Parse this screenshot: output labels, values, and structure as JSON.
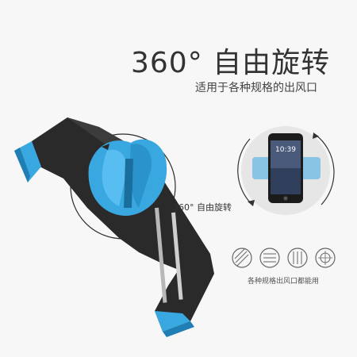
{
  "headline": "360° 自由旋转",
  "subtitle": "适用于各种规格的出风口",
  "rotate_label": "360° 自由旋转",
  "vents_caption": "各种规格出风口都能用",
  "phone_time": "10:39",
  "colors": {
    "accent_blue": "#3aa8e0",
    "body_black": "#2a2a2a",
    "background": "#f7f7f7"
  },
  "vent_icons": [
    "vent-diagonal-icon",
    "vent-horizontal-icon",
    "vent-vertical-icon",
    "vent-round-icon"
  ]
}
